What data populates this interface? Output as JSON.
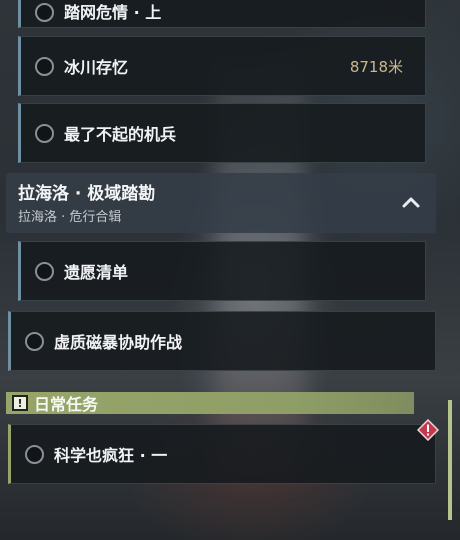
{
  "quests": {
    "top_partial": {
      "title": "踏网危情 · 上"
    },
    "glacier": {
      "title": "冰川存忆",
      "distance": "8718米"
    },
    "mech": {
      "title": "最了不起的机兵"
    },
    "wish": {
      "title": "遗愿清单"
    },
    "void": {
      "title": "虚质磁暴协助作战"
    },
    "science": {
      "title": "科学也疯狂 · 一"
    }
  },
  "group": {
    "title": "拉海洛 · 极域踏勘",
    "subtitle": "拉海洛 · 危行合辑"
  },
  "daily": {
    "title": "日常任务",
    "badge": "!"
  },
  "colors": {
    "accent_blue": "#6f8fa3",
    "daily_green": "#97a56a",
    "distance_gold": "#c9b98a",
    "alert_red": "#c23a4e"
  }
}
